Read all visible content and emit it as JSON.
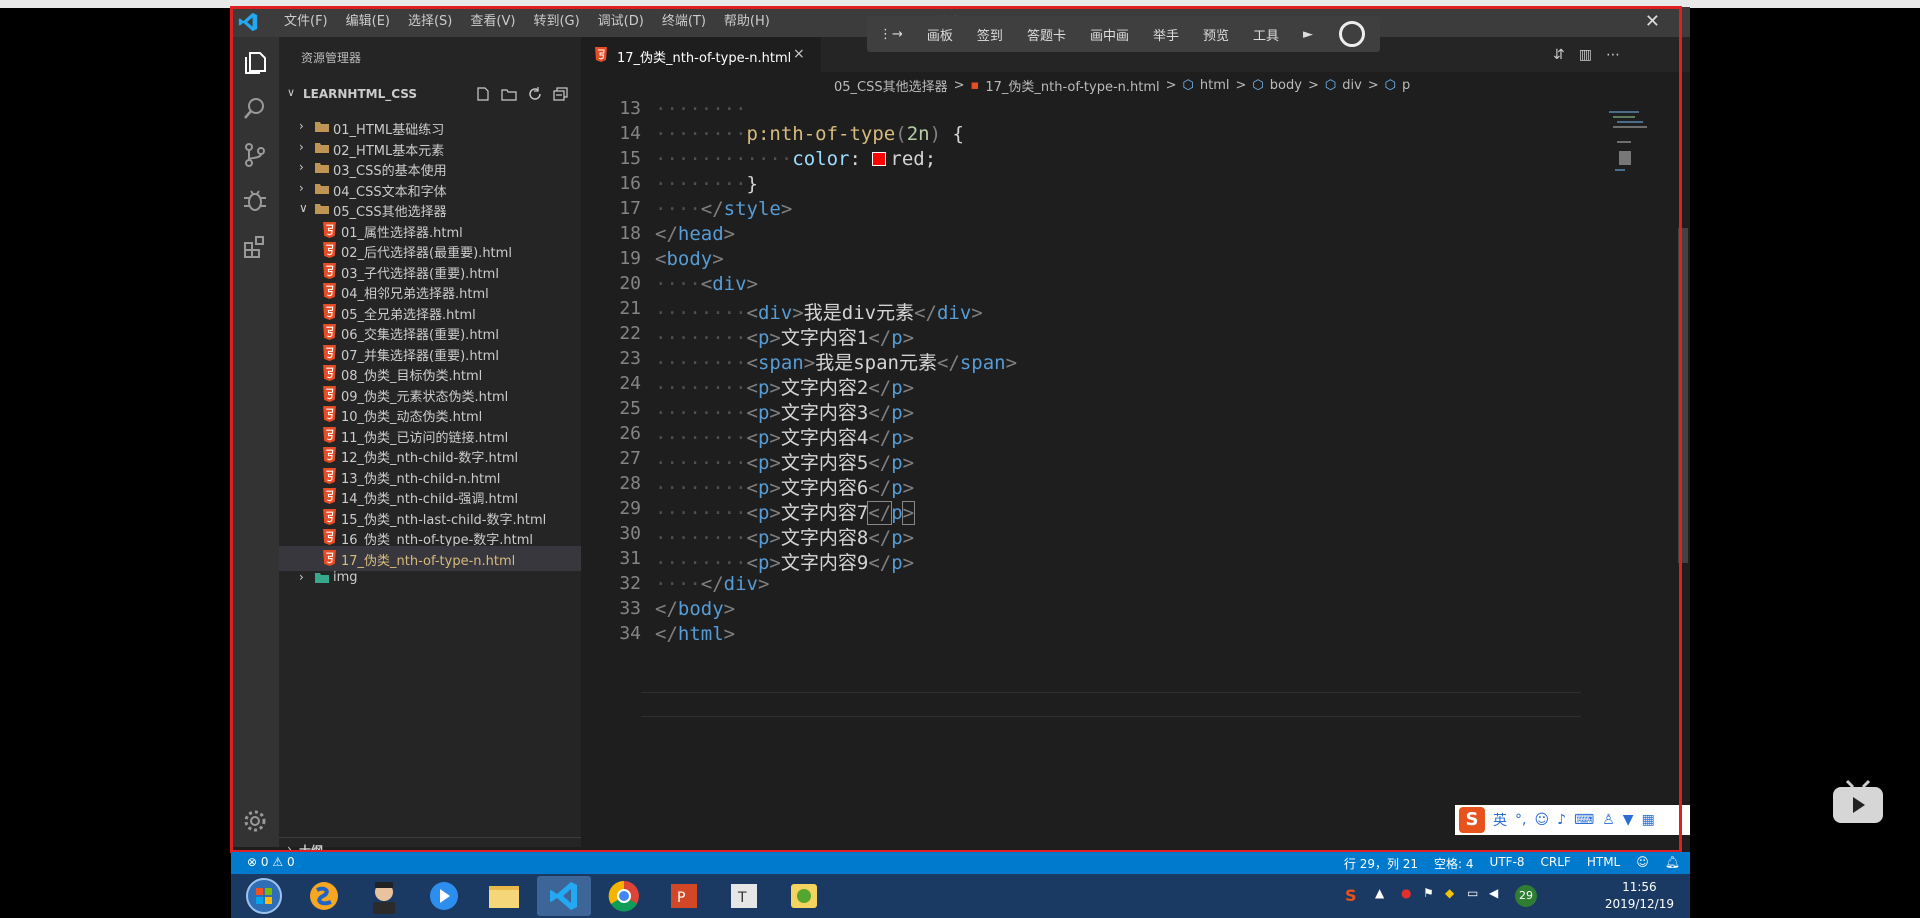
{
  "menu": [
    "文件(F)",
    "编辑(E)",
    "选择(S)",
    "查看(V)",
    "转到(G)",
    "调试(D)",
    "终端(T)",
    "帮助(H)"
  ],
  "window_title": "17_伪类_nth-of-type-n.html - ",
  "recorder_bar": [
    "画板",
    "签到",
    "答题卡",
    "画中画",
    "举手",
    "预览",
    "工具"
  ],
  "sidebar": {
    "title": "资源管理器",
    "project": "LEARNHTML_CSS",
    "folders": [
      "01_HTML基础练习",
      "02_HTML基本元素",
      "03_CSS的基本使用",
      "04_CSS文本和字体",
      "05_CSS其他选择器"
    ],
    "files": [
      "01_属性选择器.html",
      "02_后代选择器(最重要).html",
      "03_子代选择器(重要).html",
      "04_相邻兄弟选择器.html",
      "05_全兄弟选择器.html",
      "06_交集选择器(重要).html",
      "07_并集选择器(重要).html",
      "08_伪类_目标伪类.html",
      "09_伪类_元素状态伪类.html",
      "10_伪类_动态伪类.html",
      "11_伪类_已访问的链接.html",
      "12_伪类_nth-child-数字.html",
      "13_伪类_nth-child-n.html",
      "14_伪类_nth-child-强调.html",
      "15_伪类_nth-last-child-数字.html",
      "16_伪类_nth-of-type-数字.html",
      "17_伪类_nth-of-type-n.html"
    ],
    "img_folder": "img",
    "outline": "大纲"
  },
  "tab": {
    "label": "17_伪类_nth-of-type-n.html",
    "close": "×"
  },
  "breadcrumb": [
    "05_CSS其他选择器",
    ">",
    "17_伪类_nth-of-type-n.html",
    ">",
    "html",
    ">",
    "body",
    ">",
    "div",
    ">",
    "p"
  ],
  "code": {
    "l13": "13",
    "l14": "14",
    "l15": "15",
    "l16": "16",
    "l17": "17",
    "l18": "18",
    "l19": "19",
    "l20": "20",
    "l21": "21",
    "l22": "22",
    "l23": "23",
    "l24": "24",
    "l25": "25",
    "l26": "26",
    "l27": "27",
    "l28": "28",
    "l29": "29",
    "l30": "30",
    "l31": "31",
    "l32": "32",
    "l33": "33",
    "l34": "34",
    "selector": "p:nth-of-type",
    "arg": "2n",
    "prop": "color",
    "value": "red",
    "div_text": "我是div元素",
    "span_text": "我是span元素",
    "p1": "文字内容1",
    "p2": "文字内容2",
    "p3": "文字内容3",
    "p4": "文字内容4",
    "p5": "文字内容5",
    "p6": "文字内容6",
    "p7": "文字内容7",
    "p8": "文字内容8",
    "p9": "文字内容9"
  },
  "status": {
    "errors": "0",
    "warnings": "0",
    "position": "行 29，列 21",
    "spaces": "空格: 4",
    "encoding": "UTF-8",
    "eol": "CRLF",
    "language": "HTML"
  },
  "ime": {
    "mode": "英"
  },
  "taskbar": {
    "time": "11:56",
    "date": "2019/12/19",
    "badge": "29"
  },
  "colors": {
    "accent": "#007acc",
    "frame": "#e02020",
    "taskbar": "#1b3a63"
  }
}
